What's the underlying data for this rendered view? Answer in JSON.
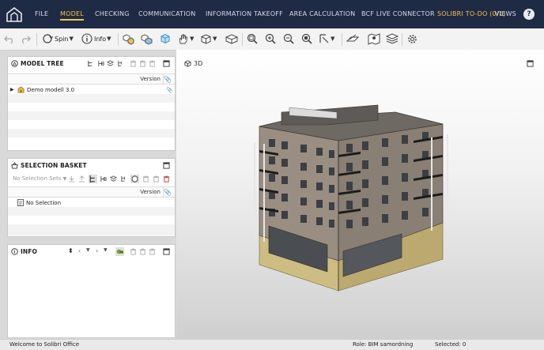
{
  "topnav": {
    "tabs": [
      "FILE",
      "MODEL",
      "CHECKING",
      "COMMUNICATION",
      "INFORMATION TAKEOFF",
      "AREA CALCULATION",
      "BCF LIVE CONNECTOR",
      "SOLIBRI TO-DO (0/1)",
      "VIEWS"
    ],
    "active": "MODEL",
    "help": "?"
  },
  "toolbar": {
    "spin_label": "Spin",
    "info_label": "Info"
  },
  "model_tree": {
    "title": "MODEL TREE",
    "version_header": "Version",
    "items": [
      {
        "name": "Demo modell 3.0"
      }
    ]
  },
  "selection_basket": {
    "title": "SELECTION BASKET",
    "sets_placeholder": "No Selection Sets",
    "version_header": "Version",
    "items": [
      {
        "name": "No Selection"
      }
    ]
  },
  "info_panel": {
    "title": "INFO"
  },
  "viewport": {
    "title": "3D"
  },
  "status": {
    "message": "Welcome to Solibri Office",
    "role": "Role: BIM samordning",
    "selected": "Selected: 0"
  },
  "colors": {
    "topbar": "#1f2a44",
    "accent": "#f2c14e"
  }
}
